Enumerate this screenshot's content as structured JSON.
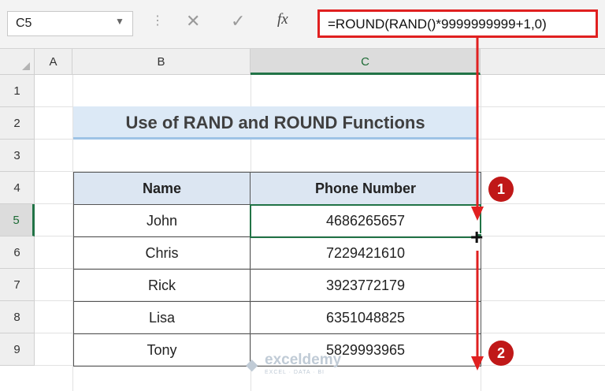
{
  "formula_bar": {
    "name_box": "C5",
    "cancel_icon": "✕",
    "enter_icon": "✓",
    "fx_label": "fx",
    "formula": "=ROUND(RAND()*9999999999+1,0)"
  },
  "columns": [
    "A",
    "B",
    "C"
  ],
  "rows": [
    "1",
    "2",
    "3",
    "4",
    "5",
    "6",
    "7",
    "8",
    "9"
  ],
  "title": "Use of RAND and ROUND Functions",
  "table": {
    "headers": [
      "Name",
      "Phone Number"
    ],
    "rows": [
      [
        "John",
        "4686265657"
      ],
      [
        "Chris",
        "7229421610"
      ],
      [
        "Rick",
        "3923772179"
      ],
      [
        "Lisa",
        "6351048825"
      ],
      [
        "Tony",
        "5829993965"
      ]
    ]
  },
  "selected_cell": "C5",
  "annotations": {
    "badge_1": "1",
    "badge_2": "2",
    "arrow_color": "#e02020"
  },
  "watermark": {
    "name": "exceldemy",
    "tagline": "EXCEL · DATA · BI"
  },
  "colors": {
    "accent_green": "#217346",
    "title_fill": "#dce9f6",
    "header_fill": "#dce6f2"
  }
}
